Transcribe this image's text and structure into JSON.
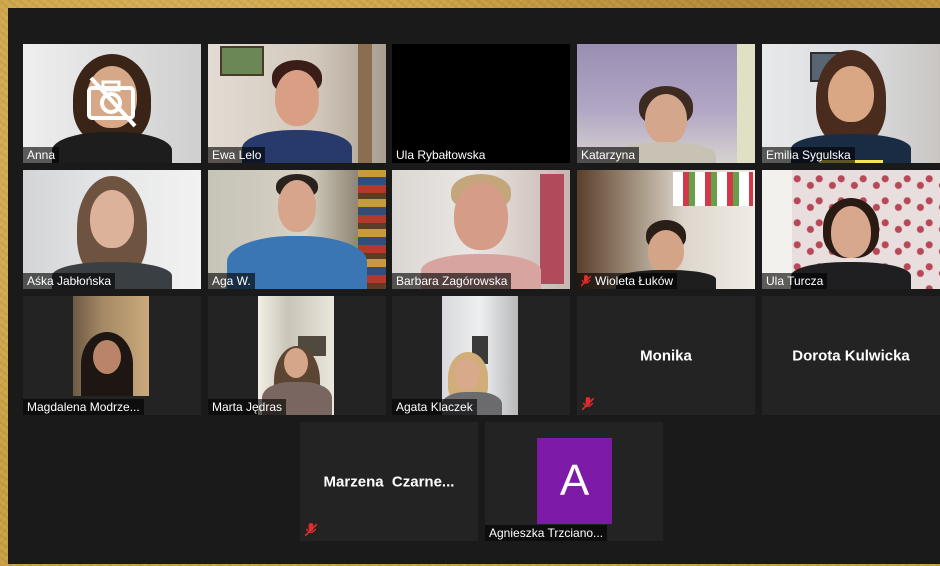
{
  "colors": {
    "window_bg": "#1a1a1a",
    "tile_bg": "#232323",
    "active_speaker_border": "#e9e56e",
    "muted_mic": "#e02d2d",
    "avatar_bg": "#7d1aa8"
  },
  "participants": [
    {
      "name": "Anna",
      "video": true,
      "camera_off_overlay": true,
      "muted": false
    },
    {
      "name": "Ewa Lelo",
      "video": true,
      "muted": false
    },
    {
      "name": "Ula Rybałtowska",
      "video": false,
      "black": true,
      "muted": false
    },
    {
      "name": "Katarzyna",
      "video": true,
      "muted": false
    },
    {
      "name": "Emilia Sygulska",
      "video": true,
      "muted": false,
      "speaking": true
    },
    {
      "name": "Aśka Jabłońska",
      "video": true,
      "muted": false
    },
    {
      "name": "Aga W.",
      "video": true,
      "muted": false
    },
    {
      "name": "Barbara Zagórowska",
      "video": true,
      "muted": false,
      "active": true
    },
    {
      "name": "Wioleta Łuków",
      "video": true,
      "muted": true
    },
    {
      "name": "Ula Turcza",
      "video": true,
      "muted": false
    },
    {
      "name": "Magdalena Modrze...",
      "video": true,
      "muted": false
    },
    {
      "name": "Marta Jędras",
      "video": true,
      "muted": false
    },
    {
      "name": "Agata Klaczek",
      "video": true,
      "muted": false
    },
    {
      "name": "Monika",
      "video": false,
      "muted": true
    },
    {
      "name": "Dorota Kulwicka",
      "video": false,
      "muted": false
    },
    {
      "name": "Marzena  Czarne...",
      "video": false,
      "muted": true
    },
    {
      "name": "Agnieszka Trzciano...",
      "video": false,
      "avatar_letter": "A",
      "muted": false
    }
  ]
}
